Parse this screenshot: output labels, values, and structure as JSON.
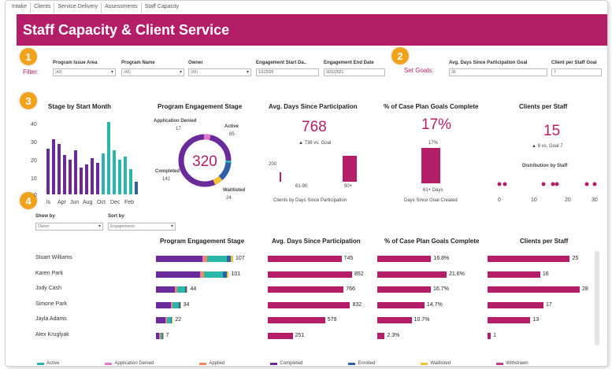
{
  "tabs": [
    "Intake",
    "Clients",
    "Service Delivery",
    "Assessments",
    "Staff Capacity"
  ],
  "title": "Staff Capacity & Client Service",
  "badges": [
    "1",
    "2",
    "3",
    "4"
  ],
  "filters": {
    "label": "Filter:",
    "fields": [
      {
        "label": "Program Issue Area",
        "value": "(All)"
      },
      {
        "label": "Program Name",
        "value": "(All)"
      },
      {
        "label": "Owner",
        "value": "(All)"
      }
    ],
    "start_label": "Engagement Start Da..",
    "start_value": "1/1/2020",
    "end_label": "Engagement End Date",
    "end_value": "3/31/2021"
  },
  "goals": {
    "label": "Set Goals:",
    "days_label": "Avg. Days Since Participation Goal",
    "days_value": "30",
    "clients_label": "Client per Staff Goal",
    "clients_value": "7"
  },
  "stage_by_month": {
    "title": "Stage by Start Month",
    "y_ticks": [
      "40",
      "30",
      "20",
      "10",
      "0"
    ],
    "x_labels": [
      "ls",
      "Apr",
      "Jun",
      "Aug",
      "Oct",
      "Dec",
      "Feb"
    ]
  },
  "engagement_stage": {
    "title": "Program Engagement Stage",
    "total": "320",
    "denied_label": "Application Denied",
    "denied_value": "17",
    "active_label": "Active",
    "active_value": "85",
    "completed_label": "Completed",
    "completed_value": "142",
    "waitlisted_label": "Waitlisted",
    "waitlisted_value": "24"
  },
  "avg_days": {
    "title": "Avg. Days Since Participation",
    "value": "768",
    "delta": "▲ 738 vs. Goal",
    "y_tick": "200",
    "x_labels": [
      "61-90",
      "90+"
    ],
    "caption": "Clients by Days Since Participation"
  },
  "goals_complete": {
    "title": "% of Case Plan Goals Complete",
    "value": "17%",
    "bar_label": "17%",
    "x_label": "61+ Days",
    "caption": "Days Since Goal Created"
  },
  "clients_per_staff": {
    "title": "Clients per Staff",
    "value": "15",
    "delta": "▲ 8 vs. Goal 7",
    "dist_title": "Distribution by Staff",
    "x_ticks": [
      "0",
      "10",
      "20",
      "30"
    ]
  },
  "controls": {
    "show_by_label": "Show by",
    "show_by_value": "Owner",
    "sort_by_label": "Sort by",
    "sort_by_value": "Engagements"
  },
  "table": {
    "col_stage": "Program Engagement Stage",
    "col_days": "Avg. Days Since Participation",
    "col_goals": "% of Case Plan Goals Complete",
    "col_clients": "Clients per Staff",
    "rows": [
      {
        "name": "Stuart Williams",
        "engagements": 107,
        "engagements_label": "107",
        "days": 745,
        "days_label": "745",
        "goals": 16.8,
        "goals_label": "16.8%",
        "clients": 25,
        "clients_label": "25"
      },
      {
        "name": "Karen Park",
        "engagements": 101,
        "engagements_label": "101",
        "days": 852,
        "days_label": "852",
        "goals": 21.6,
        "goals_label": "21.6%",
        "clients": 16,
        "clients_label": "16"
      },
      {
        "name": "Jody Cash",
        "engagements": 44,
        "engagements_label": "44",
        "days": 766,
        "days_label": "766",
        "goals": 16.7,
        "goals_label": "16.7%",
        "clients": 28,
        "clients_label": "28"
      },
      {
        "name": "Simone Park",
        "engagements": 34,
        "engagements_label": "34",
        "days": 832,
        "days_label": "832",
        "goals": 14.7,
        "goals_label": "14.7%",
        "clients": 17,
        "clients_label": "17"
      },
      {
        "name": "Jayla Adams",
        "engagements": 22,
        "engagements_label": "22",
        "days": 579,
        "days_label": "579",
        "goals": 10.7,
        "goals_label": "10.7%",
        "clients": 13,
        "clients_label": "13"
      },
      {
        "name": "Alex Kruglyak",
        "engagements": 7,
        "engagements_label": "7",
        "days": 251,
        "days_label": "251",
        "goals": 2.3,
        "goals_label": "2.3%",
        "clients": 1,
        "clients_label": "1"
      }
    ]
  },
  "legend": [
    {
      "label": "Active",
      "color": "#2ab6a8"
    },
    {
      "label": "Application Denied",
      "color": "#e07ac8"
    },
    {
      "label": "Applied",
      "color": "#f08a5d"
    },
    {
      "label": "Completed",
      "color": "#6b2a9a"
    },
    {
      "label": "Enrolled",
      "color": "#2f5fa7"
    },
    {
      "label": "Waitlisted",
      "color": "#f3c23a"
    },
    {
      "label": "Withdrawn",
      "color": "#c23b88"
    }
  ],
  "colors": {
    "accent": "#b41e68",
    "badge": "#f3a21b"
  }
}
